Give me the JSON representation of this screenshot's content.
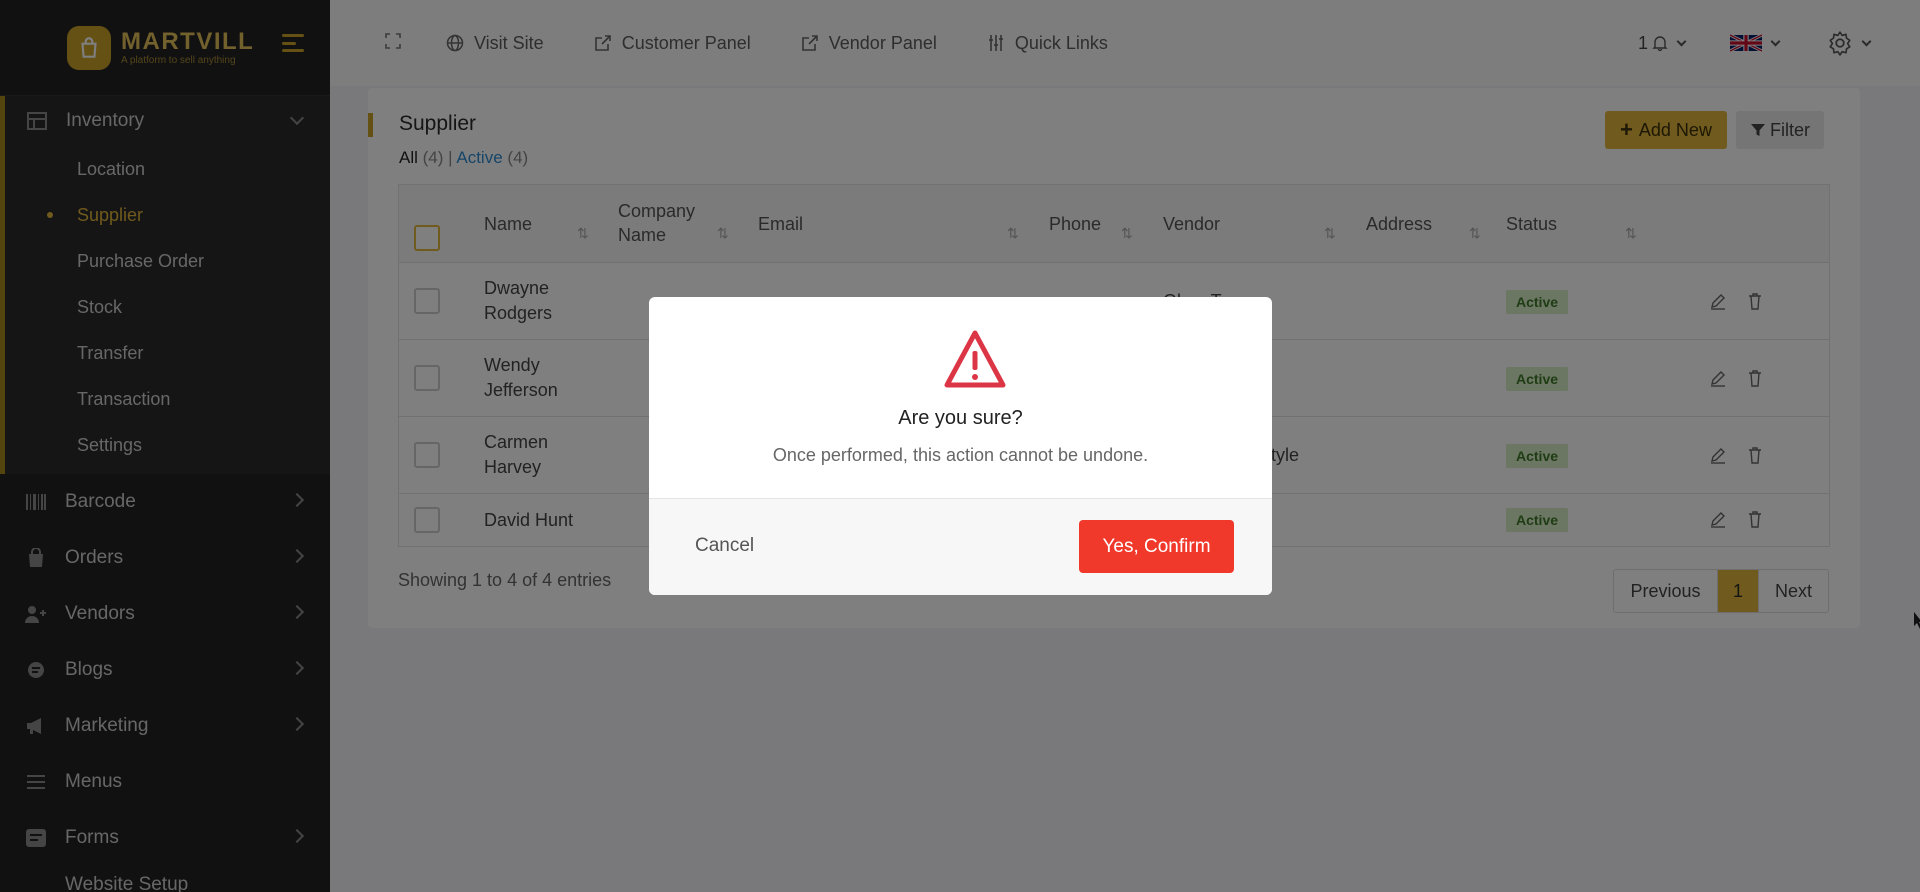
{
  "brand": {
    "name": "MARTVILL",
    "tagline": "A platform to sell anything"
  },
  "sidebar": {
    "open_group": {
      "label": "Inventory",
      "icon": "table-icon",
      "items": [
        {
          "label": "Location",
          "active": false
        },
        {
          "label": "Supplier",
          "active": true
        },
        {
          "label": "Purchase Order",
          "active": false
        },
        {
          "label": "Stock",
          "active": false
        },
        {
          "label": "Transfer",
          "active": false
        },
        {
          "label": "Transaction",
          "active": false
        },
        {
          "label": "Settings",
          "active": false
        }
      ]
    },
    "items": [
      {
        "label": "Barcode",
        "icon": "barcode-icon"
      },
      {
        "label": "Orders",
        "icon": "shopping-bag-icon"
      },
      {
        "label": "Vendors",
        "icon": "user-plus-icon"
      },
      {
        "label": "Blogs",
        "icon": "blog-icon"
      },
      {
        "label": "Marketing",
        "icon": "megaphone-icon"
      },
      {
        "label": "Menus",
        "icon": "menu-lines-icon"
      },
      {
        "label": "Forms",
        "icon": "forms-icon"
      },
      {
        "label": "Website Setup",
        "icon": "globe-icon"
      }
    ]
  },
  "topbar": {
    "links": [
      {
        "label": "Visit Site",
        "icon": "globe-icon"
      },
      {
        "label": "Customer Panel",
        "icon": "external-link-icon"
      },
      {
        "label": "Vendor Panel",
        "icon": "external-link-icon"
      },
      {
        "label": "Quick Links",
        "icon": "sliders-icon"
      }
    ],
    "notification_count": "1",
    "language": "English (UK)"
  },
  "page": {
    "title": "Supplier",
    "tab_all": "All",
    "tab_all_count": "(4)",
    "tab_separator": "|",
    "tab_active": "Active",
    "tab_active_count": "(4)",
    "add_new": "Add New",
    "filter": "Filter"
  },
  "table": {
    "columns": [
      "Name",
      "Company Name",
      "Email",
      "Phone",
      "Vendor",
      "Address",
      "Status"
    ],
    "rows": [
      {
        "name": "Dwayne Rodgers",
        "vendor": "Glam Town",
        "address": "",
        "status": "Active"
      },
      {
        "name": "Wendy Jefferson",
        "vendor": "",
        "address": "",
        "status": "Active"
      },
      {
        "name": "Carmen Harvey",
        "vendor": "",
        "address": "tyle",
        "status": "Active"
      },
      {
        "name": "David Hunt",
        "vendor": "",
        "address": "",
        "status": "Active"
      }
    ],
    "showing": "Showing 1 to 4 of 4 entries",
    "pager": {
      "previous": "Previous",
      "current": "1",
      "next": "Next"
    }
  },
  "modal": {
    "title": "Are you sure?",
    "message": "Once performed, this action cannot be undone.",
    "cancel": "Cancel",
    "confirm": "Yes, Confirm"
  },
  "colors": {
    "accent": "#e0b53a",
    "danger": "#f0392b",
    "sidebar_bg": "#232323",
    "success_badge": "#d7ecc7"
  }
}
